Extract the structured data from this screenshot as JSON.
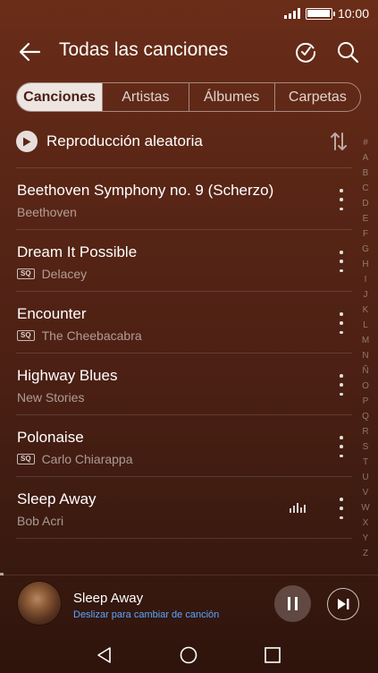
{
  "status_bar": {
    "time": "10:00"
  },
  "header": {
    "title": "Todas las canciones"
  },
  "tabs": [
    {
      "label": "Canciones",
      "active": true
    },
    {
      "label": "Artistas",
      "active": false
    },
    {
      "label": "Álbumes",
      "active": false
    },
    {
      "label": "Carpetas",
      "active": false
    }
  ],
  "shuffle": {
    "label": "Reproducción aleatoria"
  },
  "songs": [
    {
      "title": "Beethoven Symphony no. 9 (Scherzo)",
      "artist": "Beethoven",
      "sq": false,
      "playing": false
    },
    {
      "title": "Dream It Possible",
      "artist": "Delacey",
      "sq": true,
      "playing": false
    },
    {
      "title": "Encounter",
      "artist": "The Cheebacabra",
      "sq": true,
      "playing": false
    },
    {
      "title": "Highway Blues",
      "artist": "New Stories",
      "sq": false,
      "playing": false
    },
    {
      "title": "Polonaise",
      "artist": "Carlo Chiarappa",
      "sq": true,
      "playing": false
    },
    {
      "title": "Sleep Away",
      "artist": "Bob Acri",
      "sq": false,
      "playing": true
    }
  ],
  "sq_badge": "SQ",
  "alpha_index": [
    "#",
    "A",
    "B",
    "C",
    "D",
    "E",
    "F",
    "G",
    "H",
    "I",
    "J",
    "K",
    "L",
    "M",
    "N",
    "Ñ",
    "O",
    "P",
    "Q",
    "R",
    "S",
    "T",
    "U",
    "V",
    "W",
    "X",
    "Y",
    "Z"
  ],
  "now_playing": {
    "title": "Sleep Away",
    "subtitle": "Deslizar para cambiar de canción",
    "state": "playing"
  },
  "icons": {
    "back": "arrow-left-icon",
    "refresh": "refresh-icon",
    "search": "search-icon",
    "shuffle": "play-circle-icon",
    "sort": "sort-icon",
    "more": "more-vertical-icon",
    "equalizer": "equalizer-icon",
    "pause": "pause-icon",
    "next": "skip-next-icon"
  },
  "colors": {
    "accent_link": "#58a8ff",
    "background_top": "#6a2d18",
    "background_bottom": "#2e140c",
    "active_tab_bg": "#ffffffe0",
    "active_tab_text": "#4a1e10"
  }
}
